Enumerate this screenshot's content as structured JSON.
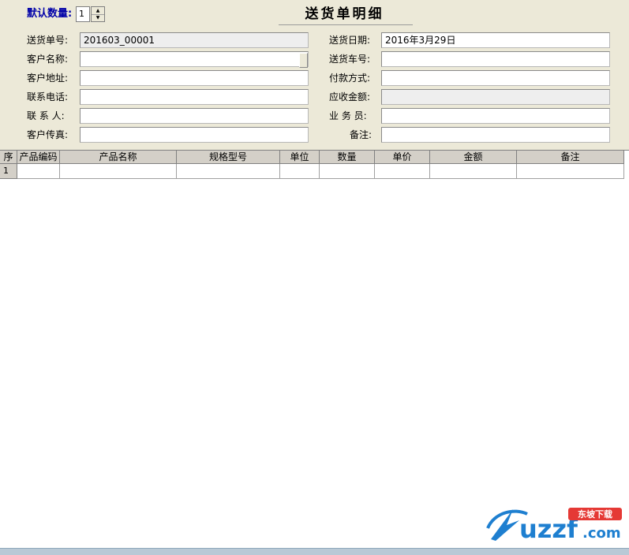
{
  "header": {
    "qty_label": "默认数量:",
    "qty_value": "1",
    "title": "送货单明细"
  },
  "form": {
    "left": [
      {
        "label": "送货单号:",
        "value": "201603_00001",
        "readonly": true
      },
      {
        "label": "客户名称:",
        "value": "",
        "dropdown": true
      },
      {
        "label": "客户地址:",
        "value": ""
      },
      {
        "label": "联系电话:",
        "value": ""
      },
      {
        "label": "联 系 人:",
        "value": ""
      },
      {
        "label": "客户传真:",
        "value": ""
      }
    ],
    "right": [
      {
        "label": "送货日期:",
        "value": "2016年3月29日"
      },
      {
        "label": "送货车号:",
        "value": ""
      },
      {
        "label": "付款方式:",
        "value": ""
      },
      {
        "label": "应收金额:",
        "value": "",
        "readonly": true
      },
      {
        "label": "业 务 员:",
        "value": ""
      },
      {
        "label": "备注:",
        "value": ""
      }
    ]
  },
  "grid": {
    "columns": [
      "序",
      "产品编码",
      "产品名称",
      "规格型号",
      "单位",
      "数量",
      "单价",
      "金额",
      "备注"
    ],
    "rows": [
      {
        "index": "1",
        "cells": [
          "",
          "",
          "",
          "",
          "",
          "",
          "",
          ""
        ]
      }
    ]
  },
  "watermark": {
    "text_main": "uzzf",
    "text_domain": ".com",
    "text_cn": "东坡下载",
    "accent": "#1e7fd0",
    "accent2": "#e53935"
  }
}
